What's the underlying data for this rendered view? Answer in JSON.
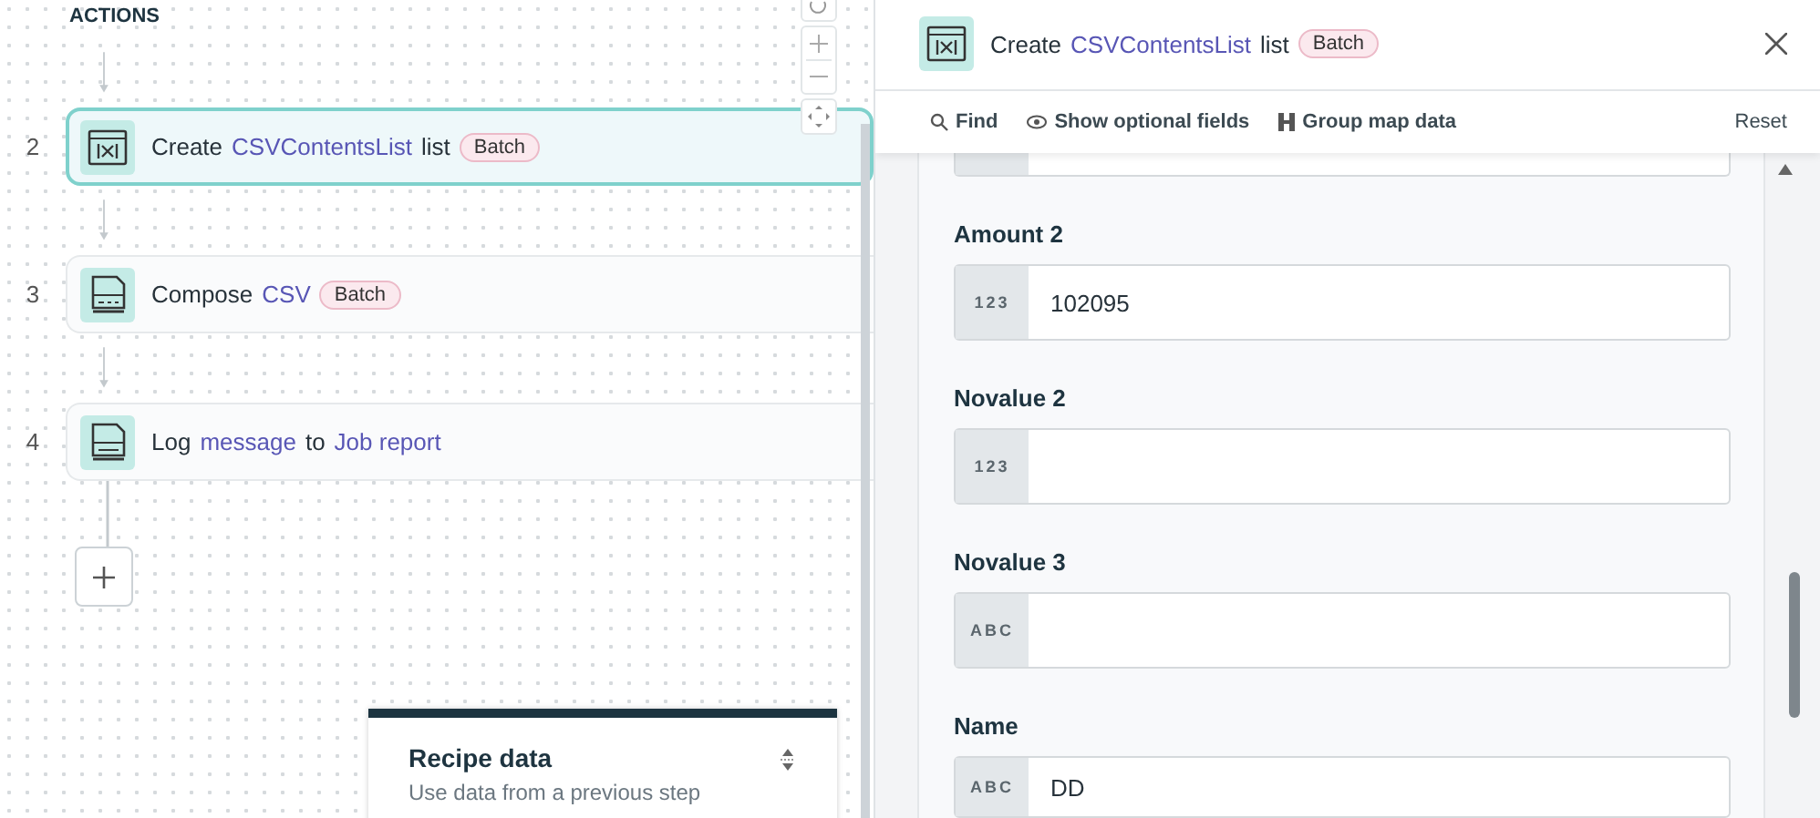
{
  "canvas": {
    "section_label": "ACTIONS",
    "steps": [
      {
        "number": "2",
        "selected": true,
        "parts": [
          {
            "text": "Create",
            "kind": "plain"
          },
          {
            "text": "CSVContentsList",
            "kind": "link"
          },
          {
            "text": "list",
            "kind": "plain"
          }
        ],
        "badge": "Batch"
      },
      {
        "number": "3",
        "selected": false,
        "parts": [
          {
            "text": "Compose",
            "kind": "plain"
          },
          {
            "text": "CSV",
            "kind": "link"
          }
        ],
        "badge": "Batch"
      },
      {
        "number": "4",
        "selected": false,
        "parts": [
          {
            "text": "Log",
            "kind": "plain"
          },
          {
            "text": "message",
            "kind": "link"
          },
          {
            "text": "to",
            "kind": "plain"
          },
          {
            "text": "Job report",
            "kind": "link"
          }
        ]
      }
    ],
    "recipe_data": {
      "title": "Recipe data",
      "subtitle": "Use data from a previous step"
    }
  },
  "panel": {
    "title_parts": [
      {
        "text": "Create",
        "kind": "plain"
      },
      {
        "text": "CSVContentsList",
        "kind": "link"
      },
      {
        "text": "list",
        "kind": "plain"
      }
    ],
    "badge": "Batch",
    "toolbar": [
      {
        "label": "Find"
      },
      {
        "label": "Show optional fields"
      },
      {
        "label": "Group map data"
      }
    ],
    "reset": "Reset",
    "fields": [
      {
        "label": "Amount 2",
        "type": "123",
        "value": "102095"
      },
      {
        "label": "Novalue 2",
        "type": "123"
      },
      {
        "label": "Novalue 3",
        "type": "ABC"
      },
      {
        "label": "Name",
        "type": "ABC",
        "value": "DD"
      }
    ]
  }
}
